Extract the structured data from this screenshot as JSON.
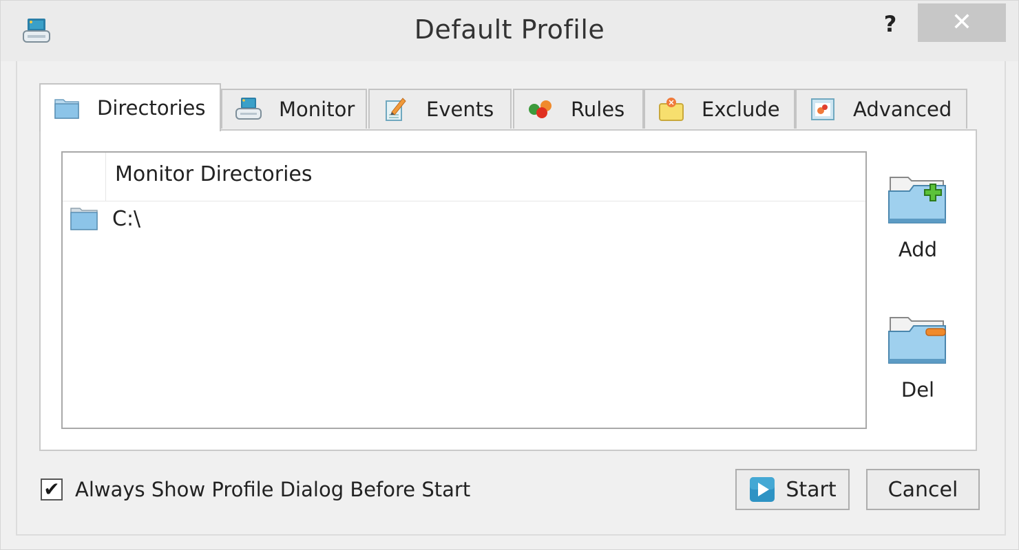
{
  "window": {
    "title": "Default Profile",
    "app_icon": "monitor-printer-icon",
    "help_label": "?",
    "close_label": "✕"
  },
  "tabs": [
    {
      "label": "Directories",
      "icon": "folder-icon",
      "active": true
    },
    {
      "label": "Monitor",
      "icon": "monitor-icon",
      "active": false
    },
    {
      "label": "Events",
      "icon": "events-notepad-icon",
      "active": false
    },
    {
      "label": "Rules",
      "icon": "rules-balls-icon",
      "active": false
    },
    {
      "label": "Exclude",
      "icon": "exclude-folder-icon",
      "active": false
    },
    {
      "label": "Advanced",
      "icon": "advanced-window-icon",
      "active": false
    }
  ],
  "directories": {
    "column_header": "Monitor Directories",
    "rows": [
      {
        "path": "C:\\",
        "icon": "folder-icon"
      }
    ]
  },
  "side_buttons": {
    "add_label": "Add",
    "del_label": "Del"
  },
  "footer": {
    "checkbox_label": "Always Show Profile Dialog Before Start",
    "checkbox_checked": true,
    "checkmark": "✔",
    "start_label": "Start",
    "cancel_label": "Cancel"
  },
  "colors": {
    "folder_blue": "#8cc4e8",
    "add_green": "#4caf2a",
    "del_orange": "#f08a2c",
    "start_blue": "#2e93c4"
  }
}
